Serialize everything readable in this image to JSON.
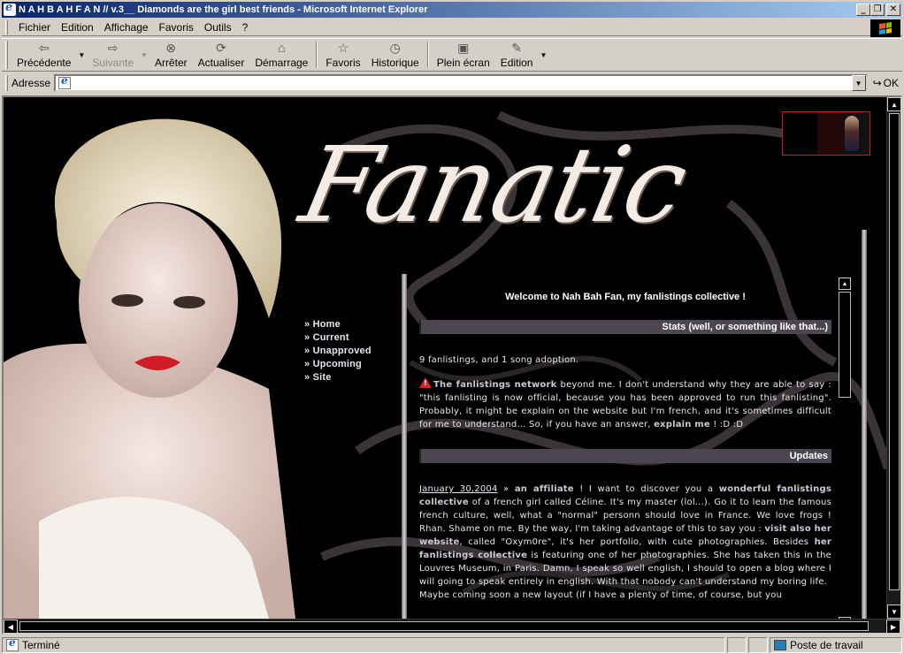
{
  "window": {
    "title": "N A H B A H F A N // v.3__ Diamonds are the girl best friends - Microsoft Internet Explorer"
  },
  "menu": {
    "items": [
      "Fichier",
      "Edition",
      "Affichage",
      "Favoris",
      "Outils",
      "?"
    ]
  },
  "toolbar": {
    "back": "Précédente",
    "forward": "Suivante",
    "stop": "Arrêter",
    "refresh": "Actualiser",
    "home": "Démarrage",
    "favorites": "Favoris",
    "history": "Historique",
    "fullscreen": "Plein écran",
    "edit": "Edition"
  },
  "address": {
    "label": "Adresse",
    "value": "",
    "go_label": "OK"
  },
  "page": {
    "logo_text": "Fanatic",
    "nav": [
      "» Home",
      "» Current",
      "» Unapproved",
      "» Upcoming",
      "» Site"
    ],
    "welcome": "Welcome to Nah Bah Fan, my fanlistings collective !",
    "stats_header": "Stats (well, or something like that...)",
    "stats_line": "9 fanlistings, and 1 song adoption.",
    "network_link": "The fanlistings network",
    "network_text": "beyond me. I don't understand why they are able to say : \"this fanlisting is now official, because you has been approved to run this fanlisting\". Probably, it might be explain on the website but I'm french, and it's sometimes difficult for me to understand... So, if you have an answer,",
    "network_link2": "explain me",
    "network_tail": "! :D :D",
    "updates_header": "Updates",
    "update_date": "January 30,2004",
    "update_arrow": "»",
    "update_link": "an affiliate",
    "update_text1": "! I want to discover you a",
    "update_link2": "wonderful fanlistings collective",
    "update_text2": "of a french girl called Céline. It's my master (lol...). Go it to learn the famous french culture, well, what a \"normal\" personn should love in France. We love frogs ! Rhan. Shame on me. By the way, I'm taking advantage of this to say you :",
    "update_link3": "visit also her website",
    "update_text3": ", called \"Oxym0re\", it's her portfolio, with cute photographies. Besides",
    "update_link4": "her fanlistings collective",
    "update_text4": "is featuring one of her photographies. She has taken this in the Louvres Museum, in Paris. Damn, I speak so well english, I should to open a blog where I will going to speak entirely in english. With that nobody can't understand my boring life.",
    "update_text5": "Maybe coming soon a new layout (if I have a plenty of time, of course, but you"
  },
  "status": {
    "main": "Terminé",
    "zone": "Poste de travail"
  },
  "colors": {
    "titlebar_start": "#0a246a",
    "titlebar_end": "#a6caf0",
    "page_bg": "#000000",
    "section_bar": "#4c4650",
    "text": "#e8e4ee"
  }
}
